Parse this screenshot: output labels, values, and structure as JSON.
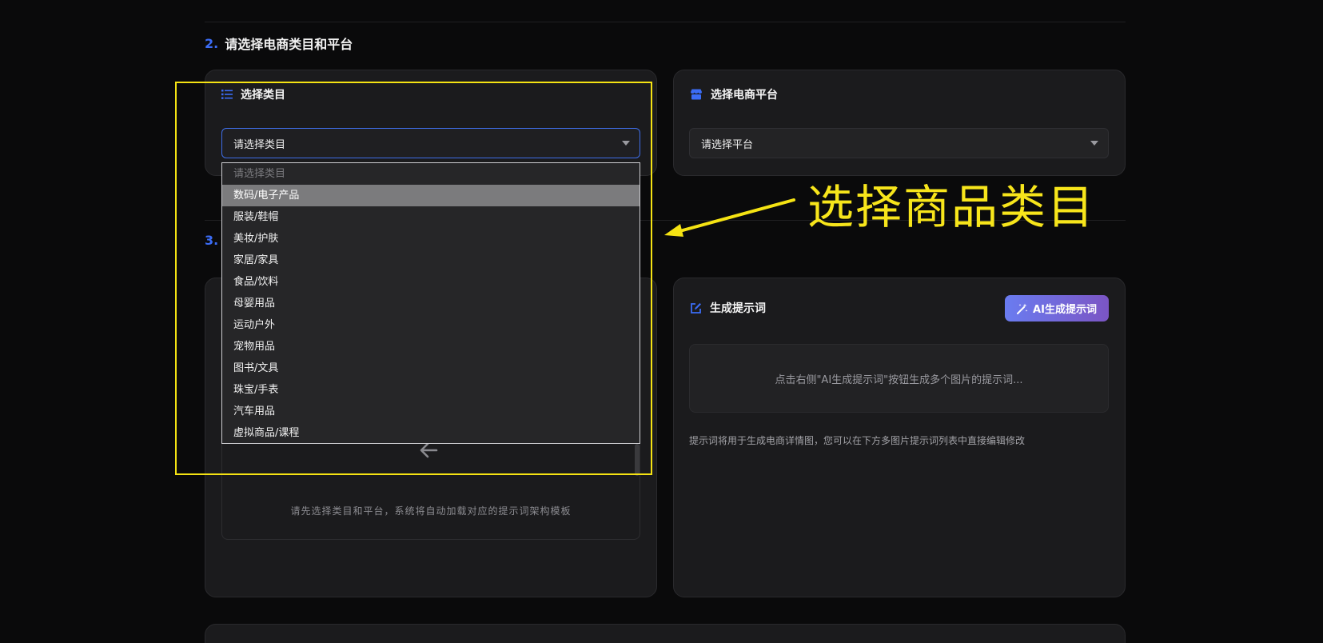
{
  "section2": {
    "number": "2.",
    "title": "请选择电商类目和平台"
  },
  "section3": {
    "number": "3."
  },
  "category_card": {
    "title": "选择类目",
    "select_value": "请选择类目",
    "options": [
      {
        "label": "请选择类目",
        "placeholder": true
      },
      {
        "label": "数码/电子产品",
        "hover": true
      },
      {
        "label": "服装/鞋帽"
      },
      {
        "label": "美妆/护肤"
      },
      {
        "label": "家居/家具"
      },
      {
        "label": "食品/饮料"
      },
      {
        "label": "母婴用品"
      },
      {
        "label": "运动户外"
      },
      {
        "label": "宠物用品"
      },
      {
        "label": "图书/文具"
      },
      {
        "label": "珠宝/手表"
      },
      {
        "label": "汽车用品"
      },
      {
        "label": "虚拟商品/课程"
      }
    ]
  },
  "platform_card": {
    "title": "选择电商平台",
    "select_value": "请选择平台"
  },
  "template_card": {
    "hint": "请先选择类目和平台，系统将自动加载对应的提示词架构模板"
  },
  "prompt_card": {
    "title": "生成提示词",
    "ai_button": "AI生成提示词",
    "placeholder": "点击右侧\"AI生成提示词\"按钮生成多个图片的提示词...",
    "hint": "提示词将用于生成电商详情图，您可以在下方多图片提示词列表中直接编辑修改"
  },
  "annotation": {
    "callout": "选择商品类目",
    "color": "#f5e313"
  },
  "icons": {
    "category": "list-icon",
    "platform": "store-icon",
    "prompt": "edit-icon",
    "ai": "magic-wand-icon",
    "back": "arrow-left-icon"
  }
}
